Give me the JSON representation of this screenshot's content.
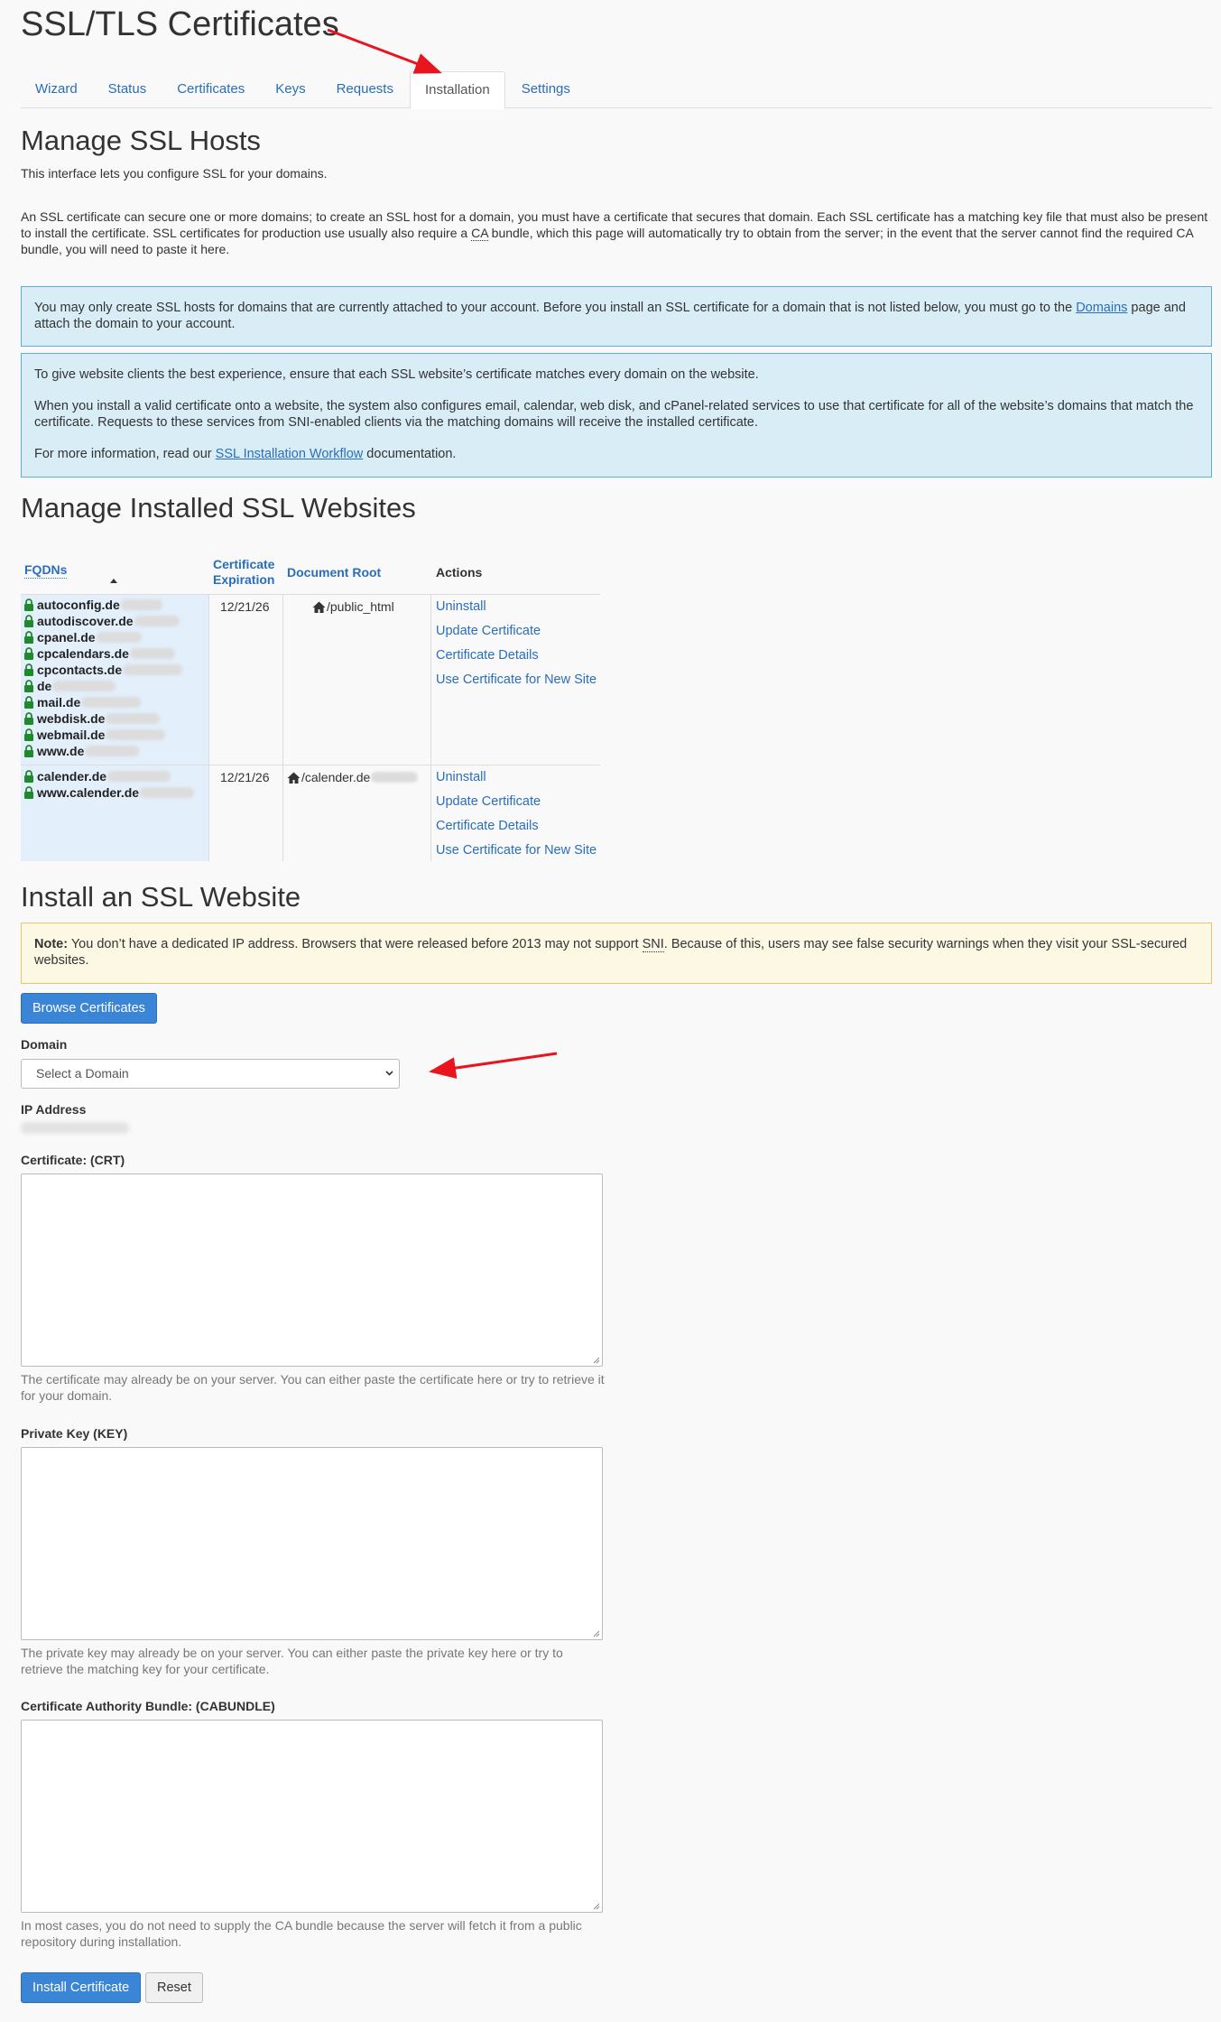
{
  "page_title": "SSL/TLS Certificates",
  "tabs": [
    {
      "label": "Wizard"
    },
    {
      "label": "Status"
    },
    {
      "label": "Certificates"
    },
    {
      "label": "Keys"
    },
    {
      "label": "Requests"
    },
    {
      "label": "Installation"
    },
    {
      "label": "Settings"
    }
  ],
  "manage_hosts": {
    "heading": "Manage SSL Hosts",
    "intro": "This interface lets you configure SSL for your domains.",
    "desc_before_ca": "An SSL certificate can secure one or more domains; to create an SSL host for a domain, you must have a certificate that secures that domain. Each SSL certificate has a matching key file that must also be present to install the certificate. SSL certificates for production use usually also require a ",
    "ca": "CA",
    "desc_after_ca": " bundle, which this page will automatically try to obtain from the server; in the event that the server cannot find the required CA bundle, you will need to paste it here."
  },
  "info1": {
    "text_before": "You may only create SSL hosts for domains that are currently attached to your account. Before you install an SSL certificate for a domain that is not listed below, you must go to the ",
    "link": "Domains",
    "text_after": " page and attach the domain to your account."
  },
  "info2": {
    "p1": "To give website clients the best experience, ensure that each SSL website’s certificate matches every domain on the website.",
    "p2": "When you install a valid certificate onto a website, the system also configures email, calendar, web disk, and cPanel-related services to use that certificate for all of the website’s domains that match the certificate. Requests to these services from SNI-enabled clients via the matching domains will receive the installed certificate.",
    "p3_before": "For more information, read our ",
    "p3_link": "SSL Installation Workflow",
    "p3_after": " documentation."
  },
  "installed": {
    "heading": "Manage Installed SSL Websites",
    "columns": {
      "fqdns": "FQDNs",
      "cert_exp_1": "Certificate",
      "cert_exp_2": "Expiration",
      "doc_root": "Document Root",
      "actions": "Actions"
    },
    "rows": [
      {
        "fqdns": [
          "autoconfig.de",
          "autodiscover.de",
          "cpanel.de",
          "cpcalendars.de",
          "cpcontacts.de",
          "de",
          "mail.de",
          "webdisk.de",
          "webmail.de",
          "www.de"
        ],
        "expiration": "12/21/26",
        "doc_root": "/public_html",
        "actions": [
          "Uninstall",
          "Update Certificate",
          "Certificate Details",
          "Use Certificate for New Site"
        ]
      },
      {
        "fqdns": [
          "calender.de",
          "www.calender.de"
        ],
        "expiration": "12/21/26",
        "doc_root": "/calender.de",
        "actions": [
          "Uninstall",
          "Update Certificate",
          "Certificate Details",
          "Use Certificate for New Site"
        ]
      }
    ]
  },
  "install": {
    "heading": "Install an SSL Website",
    "note_label": "Note:",
    "note_before": " You don’t have a dedicated IP address. Browsers that were released before 2013 may not support ",
    "note_sni": "SNI",
    "note_after": ". Because of this, users may see false security warnings when they visit your SSL-secured websites.",
    "browse_button": "Browse Certificates",
    "domain_label": "Domain",
    "domain_selected": "Select a Domain",
    "ip_label": "IP Address",
    "crt_label": "Certificate: (CRT)",
    "crt_help": "The certificate may already be on your server. You can either paste the certificate here or try to retrieve it for your domain.",
    "key_label": "Private Key (KEY)",
    "key_help": "The private key may already be on your server. You can either paste the private key here or try to retrieve the matching key for your certificate.",
    "cab_label": "Certificate Authority Bundle: (CABUNDLE)",
    "cab_help": "In most cases, you do not need to supply the CA bundle because the server will fetch it from a public repository during installation.",
    "install_button": "Install Certificate",
    "reset_button": "Reset"
  },
  "colors": {
    "link": "#2a6ebb",
    "info_bg": "#d9edf7",
    "warn_bg": "#fcf8e3",
    "lock": "#1e8a2b",
    "annotation_arrow": "#e8141e"
  }
}
